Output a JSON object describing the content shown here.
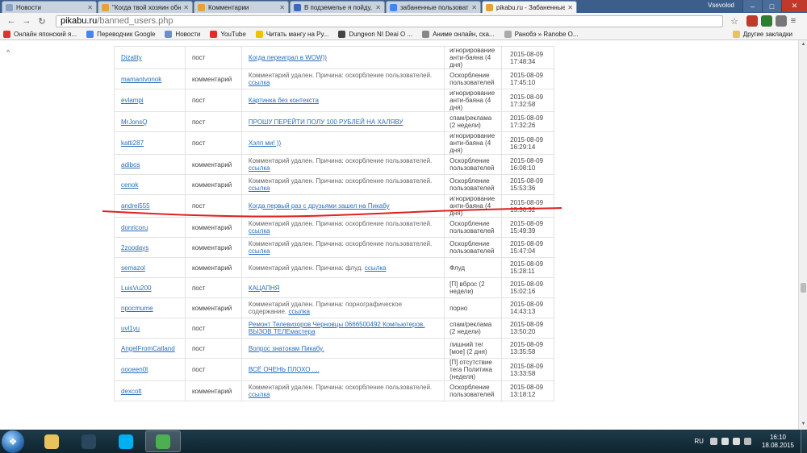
{
  "browser": {
    "tabs": [
      {
        "label": "Новости",
        "color": "#8aa4c8",
        "active": false
      },
      {
        "label": "\"Когда твой хозяин обн",
        "color": "#e3a33a",
        "active": false
      },
      {
        "label": "Комментарии",
        "color": "#e3a33a",
        "active": false
      },
      {
        "label": "В подземелье я пойду, т",
        "color": "#3b6bb5",
        "active": false
      },
      {
        "label": "забаненные пользовате",
        "color": "#4285f4",
        "active": false
      },
      {
        "label": "pikabu.ru - Забаненные",
        "color": "#e3a33a",
        "active": true
      }
    ],
    "user": "Vsevolod",
    "url_host": "pikabu.ru",
    "url_path": "/banned_users.php"
  },
  "bookmarks": [
    {
      "label": "Онлайн японский я...",
      "color": "#d33"
    },
    {
      "label": "Переводчик Google",
      "color": "#4285f4"
    },
    {
      "label": "Новости",
      "color": "#6d8fc9"
    },
    {
      "label": "YouTube",
      "color": "#e52d27"
    },
    {
      "label": "Читать мангу на Ру...",
      "color": "#f2c200"
    },
    {
      "label": "Dungeon NI Deai O ...",
      "color": "#444"
    },
    {
      "label": "Аниме онлайн, ска...",
      "color": "#888"
    },
    {
      "label": "Ранобэ » Ranobe O...",
      "color": "#aaa"
    }
  ],
  "bookmarks_other": "Другие закладки",
  "rows": [
    {
      "user": "Dizality",
      "kind": "пост",
      "type": "post",
      "msg": "Когда переиграл в WOW))",
      "link": "",
      "reason": "игнорирование анти-баяна (4 дня)",
      "date": "2015-08-09",
      "time": "17:48:34"
    },
    {
      "user": "mamantvonok",
      "kind": "комментарий",
      "type": "comment",
      "msg": "Комментарий удален. Причина: оскорбление пользователей.",
      "link": "ссылка",
      "reason": "Оскорбление пользователей",
      "date": "2015-08-09",
      "time": "17:45:10"
    },
    {
      "user": "evlampi",
      "kind": "пост",
      "type": "post",
      "msg": "Картинка без контекста",
      "link": "",
      "reason": "игнорирование анти-баяна (4 дня)",
      "date": "2015-08-09",
      "time": "17:32:58"
    },
    {
      "user": "MrJonsQ",
      "kind": "пост",
      "type": "post",
      "msg": "ПРОШУ ПЕРЕЙТИ ПОЛУ 100 РУБЛЕЙ НА ХАЛЯВУ",
      "link": "",
      "reason": "спам/реклама (2 недели)",
      "date": "2015-08-09",
      "time": "17:32:26"
    },
    {
      "user": "katti287",
      "kind": "пост",
      "type": "post",
      "msg": "Хэлп ми! ))",
      "link": "",
      "reason": "игнорирование анти-баяна (4 дня)",
      "date": "2015-08-09",
      "time": "16:29:14"
    },
    {
      "user": "adibos",
      "kind": "комментарий",
      "type": "comment",
      "msg": "Комментарий удален. Причина: оскорбление пользователей.",
      "link": "ссылка",
      "reason": "Оскорбление пользователей",
      "date": "2015-08-09",
      "time": "16:08:10"
    },
    {
      "user": "cenok",
      "kind": "комментарий",
      "type": "comment",
      "msg": "Комментарий удален. Причина: оскорбление пользователей.",
      "link": "ссылка",
      "reason": "Оскорбление пользователей",
      "date": "2015-08-09",
      "time": "15:53:36"
    },
    {
      "user": "andrei555",
      "kind": "пост",
      "type": "post",
      "msg": "Когда первый раз с друзьями зашел на Пикабу",
      "link": "",
      "reason": "игнорирование анти-баяна (4 дня)",
      "date": "2015-08-09",
      "time": "15:50:32"
    },
    {
      "user": "donricoru",
      "kind": "комментарий",
      "type": "comment",
      "msg": "Комментарий удален. Причина: оскорбление пользователей.",
      "link": "ссылка",
      "reason": "Оскорбление пользователей",
      "date": "2015-08-09",
      "time": "15:49:39"
    },
    {
      "user": "2zoodays",
      "kind": "комментарий",
      "type": "comment",
      "msg": "Комментарий удален. Причина: оскорбление пользователей.",
      "link": "ссылка",
      "reason": "Оскорбление пользователей",
      "date": "2015-08-09",
      "time": "15:47:04"
    },
    {
      "user": "semazol",
      "kind": "комментарий",
      "type": "comment",
      "msg": "Комментарий удален. Причина: флуд.",
      "link": "ссылка",
      "reason": "Флуд",
      "date": "2015-08-09",
      "time": "15:28:11"
    },
    {
      "user": "LuisVu200",
      "kind": "пост",
      "type": "post",
      "msg": "КАЦАПНЯ",
      "link": "",
      "reason": "[П] вброс (2 недели)",
      "date": "2015-08-09",
      "time": "15:02:16"
    },
    {
      "user": "npocmume",
      "kind": "комментарий",
      "type": "comment",
      "msg": "Комментарий удален. Причина: порнографическое содержание.",
      "link": "ссылка",
      "reason": "порно",
      "date": "2015-08-09",
      "time": "14:43:13"
    },
    {
      "user": "uvl1yu",
      "kind": "пост",
      "type": "post",
      "msg": "Ремонт Телевизоров Черновцы 0666500492 Компьютеров. ВЫЗОВ ТЕЛЕмастера",
      "link": "",
      "reason": "спам/реклама (2 недели)",
      "date": "2015-08-09",
      "time": "13:50:20"
    },
    {
      "user": "AngelFromCatland",
      "kind": "пост",
      "type": "post",
      "msg": "Вопрос знатокам Пикабу.",
      "link": "",
      "reason": "лишний тег [мое] (2 дня)",
      "date": "2015-08-09",
      "time": "13:35:58"
    },
    {
      "user": "oooeen0t",
      "kind": "пост",
      "type": "post",
      "msg": "ВСЁ ОЧЕНЬ ПЛОХО ....",
      "link": "",
      "reason": "[П] отсутствие тега Политика (неделя)",
      "date": "2015-08-09",
      "time": "13:33:58"
    },
    {
      "user": "dexcolt",
      "kind": "комментарий",
      "type": "comment",
      "msg": "Комментарий удален. Причина: оскорбление пользователей.",
      "link": "ссылка",
      "reason": "Оскорбление пользователей",
      "date": "2015-08-09",
      "time": "13:18:12"
    }
  ],
  "taskbar": {
    "apps": [
      {
        "name": "folder",
        "color": "#e8c25a",
        "active": false
      },
      {
        "name": "steam",
        "color": "#2a475e",
        "active": false
      },
      {
        "name": "skype",
        "color": "#00aff0",
        "active": false
      },
      {
        "name": "chrome",
        "color": "#4caf50",
        "active": true
      }
    ],
    "lang": "RU",
    "time": "16:10",
    "date": "18.08.2015"
  }
}
